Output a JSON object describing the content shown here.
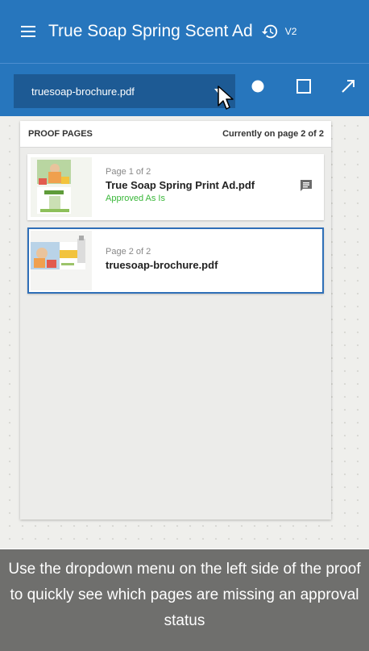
{
  "header": {
    "title": "True Soap Spring Scent Ad",
    "version": "V2"
  },
  "toolbar": {
    "file_select_value": "truesoap-brochure.pdf",
    "tools": [
      "circle-tool-icon",
      "rectangle-tool-icon",
      "arrow-tool-icon"
    ]
  },
  "proof_panel": {
    "title": "PROOF PAGES",
    "current_page_text": "Currently on page 2 of 2",
    "pages": [
      {
        "page_label": "Page 1 of 2",
        "file_name": "True Soap Spring Print Ad.pdf",
        "status": "Approved As Is",
        "has_comment": true,
        "selected": false
      },
      {
        "page_label": "Page 2 of 2",
        "file_name": "truesoap-brochure.pdf",
        "status": "",
        "has_comment": false,
        "selected": true
      }
    ]
  },
  "caption": {
    "text": "Use the dropdown menu on the left side of the proof to quickly see which pages are missing an approval status"
  },
  "colors": {
    "primary": "#2776bd",
    "select_bg": "#1d5a94",
    "approved": "#39b739",
    "selected_border": "#2f6fb8",
    "caption_bg": "#6f6f6d"
  }
}
